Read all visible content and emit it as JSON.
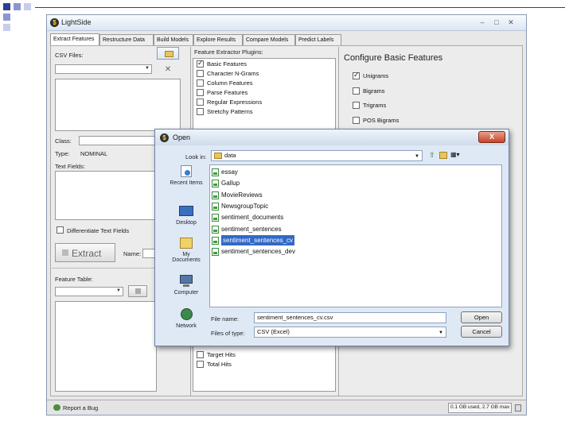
{
  "app": {
    "title": "LightSide",
    "tabs": [
      "Extract Features",
      "Restructure Data",
      "Build Models",
      "Explore Results",
      "Compare Models",
      "Predict Labels"
    ],
    "left": {
      "csv_files_label": "CSV Files:",
      "class_label": "Class:",
      "type_label": "Type:",
      "type_value": "NOMINAL",
      "text_fields_label": "Text Fields:",
      "differentiate_label": "Differentiate Text Fields",
      "extract_button": "Extract",
      "name_label": "Name:",
      "feature_table_label": "Feature Table:"
    },
    "plugins": {
      "heading": "Feature Extractor Plugins:",
      "items": [
        {
          "label": "Basic Features",
          "checked": true
        },
        {
          "label": "Character N-Grams",
          "checked": false
        },
        {
          "label": "Column Features",
          "checked": false
        },
        {
          "label": "Parse Features",
          "checked": false
        },
        {
          "label": "Regular Expressions",
          "checked": false
        },
        {
          "label": "Stretchy Patterns",
          "checked": false
        }
      ],
      "lower_items": [
        {
          "label": "Target Hits",
          "checked": false
        },
        {
          "label": "Total Hits",
          "checked": false
        }
      ]
    },
    "configure": {
      "heading": "Configure Basic Features",
      "options": [
        {
          "label": "Unigrams",
          "checked": true
        },
        {
          "label": "Bigrams",
          "checked": false
        },
        {
          "label": "Trigrams",
          "checked": false
        },
        {
          "label": "POS Bigrams",
          "checked": false
        }
      ]
    },
    "status": {
      "left": "Report a Bug",
      "memory": "0.1 GB used, 2.7 GB max"
    }
  },
  "dialog": {
    "title": "Open",
    "look_in_label": "Look in:",
    "look_in_value": "data",
    "close_glyph": "X",
    "places": [
      "Recent Items",
      "Desktop",
      "My Documents",
      "Computer",
      "Network"
    ],
    "files": [
      {
        "name": "essay",
        "selected": false
      },
      {
        "name": "Gallup",
        "selected": false
      },
      {
        "name": "MovieReviews",
        "selected": false
      },
      {
        "name": "NewsgroupTopic",
        "selected": false
      },
      {
        "name": "sentiment_documents",
        "selected": false
      },
      {
        "name": "sentiment_sentences",
        "selected": false
      },
      {
        "name": "sentiment_sentences_cv",
        "selected": true
      },
      {
        "name": "sentiment_sentences_dev",
        "selected": false
      }
    ],
    "file_name_label": "File name:",
    "file_name_value": "sentiment_sentences_cv.csv",
    "file_type_label": "Files of type:",
    "file_type_value": "CSV (Excel)",
    "open_button": "Open",
    "cancel_button": "Cancel"
  }
}
